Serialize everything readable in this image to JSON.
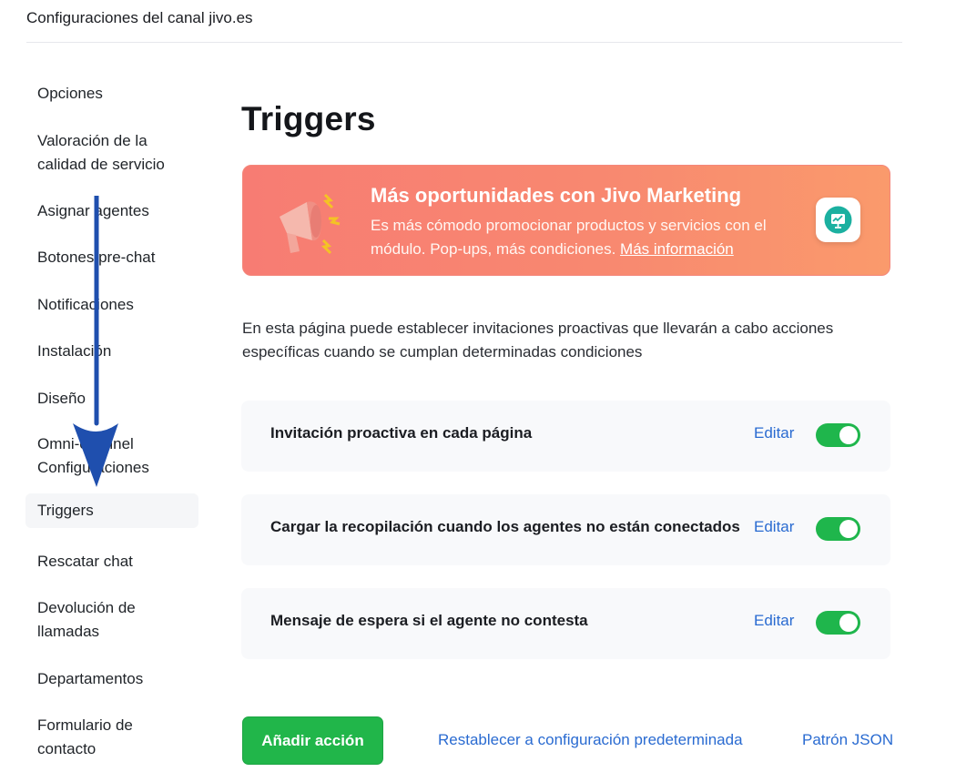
{
  "header": {
    "title": "Configuraciones del canal jivo.es"
  },
  "sidebar": {
    "items": [
      {
        "label": "Opciones"
      },
      {
        "label": "Valoración de la calidad de servicio"
      },
      {
        "label": "Asignar agentes"
      },
      {
        "label": "Botones pre-chat"
      },
      {
        "label": "Notificaciones"
      },
      {
        "label": "Instalación"
      },
      {
        "label": "Diseño"
      },
      {
        "label": "Omni-channel Configuraciones"
      },
      {
        "label": "Triggers",
        "active": true
      },
      {
        "label": "Rescatar chat"
      },
      {
        "label": "Devolución de llamadas"
      },
      {
        "label": "Departamentos"
      },
      {
        "label": "Formulario de contacto"
      }
    ]
  },
  "main": {
    "title": "Triggers",
    "promo": {
      "title": "Más oportunidades con Jivo Marketing",
      "text": "Es más cómodo promocionar productos y servicios con el módulo. Pop-ups, más condiciones.",
      "link": "Más información",
      "icon": "jivo-marketing-app-icon",
      "illustration": "megaphone-icon"
    },
    "description": "En esta página puede establecer invitaciones proactivas que llevarán a cabo acciones específicas cuando se cumplan determinadas condiciones",
    "triggers": [
      {
        "name": "Invitación proactiva en cada página",
        "edit": "Editar",
        "enabled": true
      },
      {
        "name": "Cargar la recopilación cuando los agentes no están conectados",
        "edit": "Editar",
        "enabled": true
      },
      {
        "name": "Mensaje de espera si el agente no contesta",
        "edit": "Editar",
        "enabled": true
      }
    ],
    "actions": {
      "add": "Añadir acción",
      "reset": "Restablecer a configuración predeterminada",
      "json": "Patrón JSON"
    }
  },
  "colors": {
    "accent_green": "#21b64a",
    "link_blue": "#2a6bd1",
    "promo_gradient_start": "#f77c73",
    "promo_gradient_end": "#fa9a6c",
    "annotation_arrow": "#1f4fae"
  }
}
